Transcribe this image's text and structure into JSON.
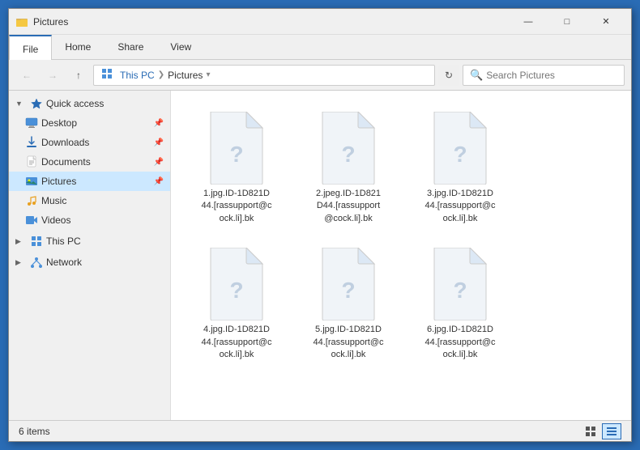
{
  "window": {
    "title": "Pictures",
    "icon": "folder-icon"
  },
  "ribbon": {
    "tabs": [
      "File",
      "Home",
      "Share",
      "View"
    ],
    "active_tab": "File"
  },
  "address_bar": {
    "back_enabled": false,
    "forward_enabled": false,
    "crumbs": [
      "This PC",
      "Pictures"
    ],
    "search_placeholder": "Search Pictures"
  },
  "sidebar": {
    "sections": [
      {
        "id": "quick-access",
        "label": "Quick access",
        "expanded": true,
        "items": [
          {
            "id": "desktop",
            "label": "Desktop",
            "pinned": true,
            "icon": "desktop-icon"
          },
          {
            "id": "downloads",
            "label": "Downloads",
            "pinned": true,
            "icon": "downloads-icon"
          },
          {
            "id": "documents",
            "label": "Documents",
            "pinned": true,
            "icon": "documents-icon"
          },
          {
            "id": "pictures",
            "label": "Pictures",
            "pinned": true,
            "selected": true,
            "icon": "pictures-icon"
          },
          {
            "id": "music",
            "label": "Music",
            "icon": "music-icon"
          },
          {
            "id": "videos",
            "label": "Videos",
            "icon": "videos-icon"
          }
        ]
      },
      {
        "id": "this-pc",
        "label": "This PC",
        "expanded": false,
        "icon": "computer-icon"
      },
      {
        "id": "network",
        "label": "Network",
        "expanded": false,
        "icon": "network-icon"
      }
    ]
  },
  "files": [
    {
      "id": "file1",
      "name": "1.jpg.ID-1D821D\n44.[rassupport@c\nock.li].bk"
    },
    {
      "id": "file2",
      "name": "2.jpeg.ID-1D821\nD44.[rassupport\n@cock.li].bk"
    },
    {
      "id": "file3",
      "name": "3.jpg.ID-1D821D\n44.[rassupport@c\nock.li].bk"
    },
    {
      "id": "file4",
      "name": "4.jpg.ID-1D821D\n44.[rassupport@c\nock.li].bk"
    },
    {
      "id": "file5",
      "name": "5.jpg.ID-1D821D\n44.[rassupport@c\nock.li].bk"
    },
    {
      "id": "file6",
      "name": "6.jpg.ID-1D821D\n44.[rassupport@c\nock.li].bk"
    }
  ],
  "status_bar": {
    "item_count": "6 items"
  },
  "title_bar_controls": {
    "minimize": "—",
    "maximize": "□",
    "close": "✕"
  }
}
